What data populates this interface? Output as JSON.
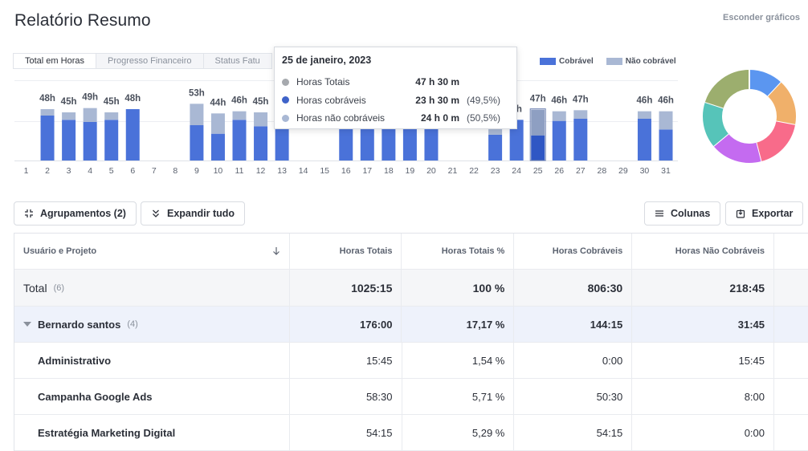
{
  "page": {
    "title": "Relatório Resumo",
    "hide_charts": "Esconder gráficos"
  },
  "tabs": [
    {
      "label": "Total em Horas"
    },
    {
      "label": "Progresso Financeiro"
    },
    {
      "label": "Status Fatu"
    }
  ],
  "legend": [
    {
      "label": "Cobrável",
      "color": "#4a72d9"
    },
    {
      "label": "Não cobrável",
      "color": "#a9b8d4"
    }
  ],
  "chart_data": [
    {
      "type": "bar",
      "stacked": true,
      "categories": [
        "1",
        "2",
        "3",
        "4",
        "5",
        "6",
        "7",
        "8",
        "9",
        "10",
        "11",
        "12",
        "13",
        "14",
        "15",
        "16",
        "17",
        "18",
        "19",
        "20",
        "21",
        "22",
        "23",
        "24",
        "25",
        "26",
        "27",
        "28",
        "29",
        "30",
        "31"
      ],
      "top_labels": [
        "",
        "48h",
        "45h",
        "49h",
        "45h",
        "48h",
        "",
        "",
        "53h",
        "44h",
        "46h",
        "45h",
        "",
        "",
        "",
        "",
        "",
        "",
        "",
        "",
        "",
        "",
        "",
        "6h",
        "47h",
        "46h",
        "47h",
        "",
        "",
        "46h",
        "46h"
      ],
      "series": [
        {
          "name": "Cobrável",
          "values": [
            0,
            42,
            38,
            36,
            38,
            48,
            0,
            0,
            33,
            25,
            38,
            32,
            36,
            0,
            0,
            33,
            36,
            36,
            36,
            36,
            0,
            0,
            24,
            38,
            23.5,
            37,
            39,
            0,
            0,
            39,
            29
          ]
        },
        {
          "name": "Não cobrável",
          "values": [
            0,
            6,
            7,
            13,
            7,
            0,
            0,
            0,
            20,
            19,
            8,
            13,
            0,
            0,
            0,
            0,
            0,
            0,
            0,
            0,
            0,
            0,
            12,
            0,
            24,
            9,
            8,
            0,
            0,
            7,
            17
          ]
        }
      ],
      "highlight_index": 24,
      "ylim": [
        0,
        60
      ],
      "colors": {
        "billable": "#4a72d9",
        "non_billable": "#a9b8d4",
        "highlight_billable": "#2f57c4",
        "highlight_non_billable": "#8e9fc2"
      }
    },
    {
      "type": "pie",
      "variant": "donut",
      "values": [
        12,
        16,
        18,
        18,
        16,
        20
      ],
      "colors": [
        "#5b96f0",
        "#f0b06a",
        "#f86b8a",
        "#c46bf0",
        "#56c4b9",
        "#9cae6e"
      ]
    }
  ],
  "tooltip": {
    "date": "25 de janeiro, 2023",
    "rows": [
      {
        "label": "Horas Totais",
        "value": "47 h 30 m",
        "pct": "",
        "color": "#a6a9ae"
      },
      {
        "label": "Horas cobráveis",
        "value": "23 h 30 m",
        "pct": "(49,5%)",
        "color": "#3f63c9"
      },
      {
        "label": "Horas não cobráveis",
        "value": "24 h 0 m",
        "pct": "(50,5%)",
        "color": "#a9b8d4"
      }
    ]
  },
  "toolbar": {
    "groupings_label": "Agrupamentos (2)",
    "expand_label": "Expandir tudo",
    "columns_label": "Colunas",
    "export_label": "Exportar"
  },
  "table": {
    "headers": [
      "Usuário e Projeto",
      "Horas Totais",
      "Horas Totais %",
      "Horas Cobráveis",
      "Horas Não Cobráveis"
    ],
    "total": {
      "label": "Total",
      "count": "(6)",
      "values": [
        "1025:15",
        "100 %",
        "806:30",
        "218:45"
      ]
    },
    "group": {
      "label": "Bernardo santos",
      "count": "(4)",
      "values": [
        "176:00",
        "17,17 %",
        "144:15",
        "31:45"
      ]
    },
    "rows": [
      {
        "label": "Administrativo",
        "values": [
          "15:45",
          "1,54 %",
          "0:00",
          "15:45"
        ]
      },
      {
        "label": "Campanha Google Ads",
        "values": [
          "58:30",
          "5,71 %",
          "50:30",
          "8:00"
        ]
      },
      {
        "label": "Estratégia Marketing Digital",
        "values": [
          "54:15",
          "5,29 %",
          "54:15",
          "0:00"
        ]
      }
    ]
  }
}
